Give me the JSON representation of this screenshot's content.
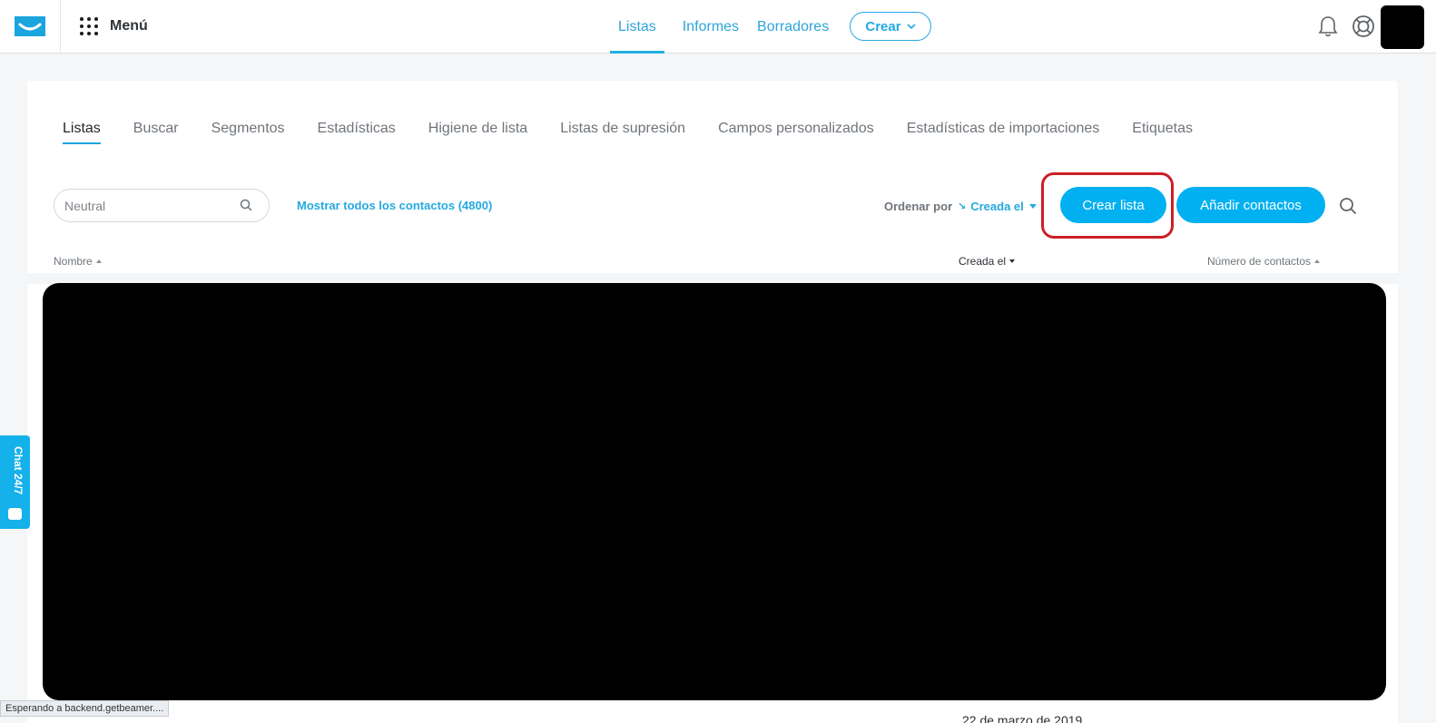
{
  "header": {
    "menu_label": "Menú",
    "nav": [
      {
        "label": "Listas",
        "active": true
      },
      {
        "label": "Informes",
        "active": false
      },
      {
        "label": "Borradores",
        "active": false
      }
    ],
    "create_label": "Crear",
    "icons": [
      "envelope-logo-icon",
      "grid-menu-icon",
      "bell-icon",
      "help-lifebuoy-icon",
      "chevron-down-icon"
    ]
  },
  "tabs": [
    {
      "label": "Listas",
      "active": true
    },
    {
      "label": "Buscar",
      "active": false
    },
    {
      "label": "Segmentos",
      "active": false
    },
    {
      "label": "Estadísticas",
      "active": false
    },
    {
      "label": "Higiene de lista",
      "active": false
    },
    {
      "label": "Listas de supresión",
      "active": false
    },
    {
      "label": "Campos personalizados",
      "active": false
    },
    {
      "label": "Estadísticas de importaciones",
      "active": false
    },
    {
      "label": "Etiquetas",
      "active": false
    }
  ],
  "toolbar": {
    "search_placeholder": "Neutral",
    "show_all_label": "Mostrar todos los contactos (4800)",
    "order_by_label": "Ordenar por",
    "order_value": "Creada el",
    "create_list_label": "Crear lista",
    "add_contacts_label": "Añadir contactos"
  },
  "table": {
    "columns": [
      "Nombre",
      "Creada el",
      "Número de contactos"
    ],
    "bottom_row_partial": "22 de marzo de 2019"
  },
  "chat": {
    "label": "Chat 24/7"
  },
  "status_bar": "Esperando a backend.getbeamer....",
  "colors": {
    "accent": "#00b0f0",
    "nav_link": "#2fa5d8",
    "highlight_ring": "#cc1f26",
    "chat_tab": "#14b1ea"
  }
}
